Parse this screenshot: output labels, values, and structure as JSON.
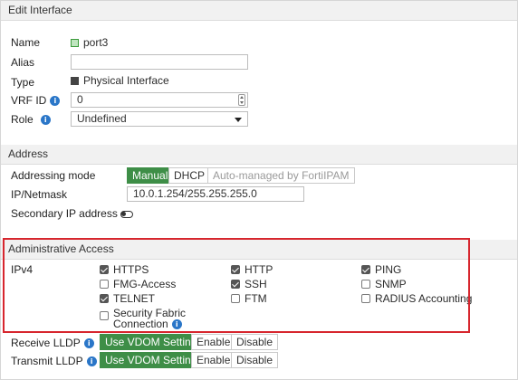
{
  "title": "Edit Interface",
  "general": {
    "name_label": "Name",
    "name_value": "port3",
    "alias_label": "Alias",
    "alias_value": "",
    "type_label": "Type",
    "type_value": "Physical Interface",
    "vrf_label": "VRF ID",
    "vrf_value": "0",
    "role_label": "Role",
    "role_value": "Undefined"
  },
  "address": {
    "section_title": "Address",
    "mode_label": "Addressing mode",
    "modes": [
      "Manual",
      "DHCP",
      "Auto-managed by FortiIPAM"
    ],
    "selected_mode": "Manual",
    "ip_label": "IP/Netmask",
    "ip_value": "10.0.1.254/255.255.255.0",
    "secondary_label": "Secondary IP address",
    "secondary_enabled": false
  },
  "admin_access": {
    "section_title": "Administrative Access",
    "ipv4_label": "IPv4",
    "options": [
      {
        "label": "HTTPS",
        "checked": true
      },
      {
        "label": "HTTP",
        "checked": true
      },
      {
        "label": "PING",
        "checked": true
      },
      {
        "label": "FMG-Access",
        "checked": false
      },
      {
        "label": "SSH",
        "checked": true
      },
      {
        "label": "SNMP",
        "checked": false
      },
      {
        "label": "TELNET",
        "checked": true
      },
      {
        "label": "FTM",
        "checked": false
      },
      {
        "label": "RADIUS Accounting",
        "checked": false
      }
    ],
    "sf_line1": "Security Fabric",
    "sf_line2": "Connection",
    "sf_checked": false
  },
  "lldp": {
    "receive_label": "Receive LLDP",
    "transmit_label": "Transmit LLDP",
    "options": [
      "Use VDOM Setting",
      "Enable",
      "Disable"
    ],
    "receive_selected": "Use VDOM Setting",
    "transmit_selected": "Use VDOM Setting"
  },
  "colors": {
    "accent_green": "#3e8e47",
    "info_blue": "#2a76c8",
    "highlight_red": "#d7262e"
  },
  "icons": {
    "info": "i"
  }
}
